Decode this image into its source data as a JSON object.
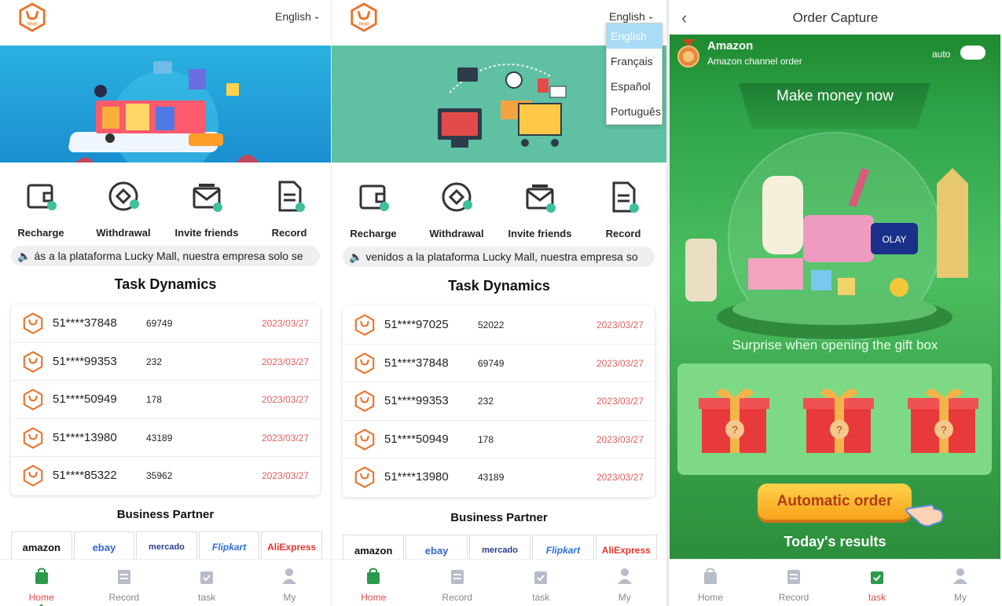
{
  "screen1": {
    "language": "English",
    "actions": [
      "Recharge",
      "Withdrawal",
      "Invite friends",
      "Record"
    ],
    "marquee": "ás a la plataforma Lucky Mall, nuestra empresa solo se",
    "task_title": "Task Dynamics",
    "tasks": [
      {
        "id": "51****37848",
        "amount": "69749",
        "date": "2023/03/27"
      },
      {
        "id": "51****99353",
        "amount": "232",
        "date": "2023/03/27"
      },
      {
        "id": "51****50949",
        "amount": "178",
        "date": "2023/03/27"
      },
      {
        "id": "51****13980",
        "amount": "43189",
        "date": "2023/03/27"
      },
      {
        "id": "51****85322",
        "amount": "35962",
        "date": "2023/03/27"
      }
    ],
    "partner_title": "Business Partner",
    "partners": [
      "amazon",
      "ebay",
      "mercado",
      "Flipkart",
      "AliExpress"
    ],
    "tabs": [
      "Home",
      "Record",
      "task",
      "My"
    ]
  },
  "screen2": {
    "language": "English",
    "language_options": [
      "English",
      "Français",
      "Español",
      "Português"
    ],
    "actions": [
      "Recharge",
      "Withdrawal",
      "Invite friends",
      "Record"
    ],
    "marquee": "venidos a la plataforma Lucky Mall, nuestra empresa so",
    "task_title": "Task Dynamics",
    "tasks": [
      {
        "id": "51****97025",
        "amount": "52022",
        "date": "2023/03/27"
      },
      {
        "id": "51****37848",
        "amount": "69749",
        "date": "2023/03/27"
      },
      {
        "id": "51****99353",
        "amount": "232",
        "date": "2023/03/27"
      },
      {
        "id": "51****50949",
        "amount": "178",
        "date": "2023/03/27"
      },
      {
        "id": "51****13980",
        "amount": "43189",
        "date": "2023/03/27"
      }
    ],
    "partner_title": "Business Partner",
    "partners": [
      "amazon",
      "ebay",
      "mercado",
      "Flipkart",
      "AliExpress"
    ],
    "tabs": [
      "Home",
      "Record",
      "task",
      "My"
    ]
  },
  "screen3": {
    "title": "Order Capture",
    "channel_name": "Amazon",
    "channel_sub": "Amazon channel order",
    "auto_label": "auto",
    "headline": "Make money now",
    "surprise": "Surprise when opening the gift box",
    "button": "Automatic order",
    "results": "Today's results",
    "tabs": [
      "Home",
      "Record",
      "task",
      "My"
    ]
  },
  "colors": {
    "brand": "#e8732c",
    "accent_green": "#2b9a4a",
    "date_red": "#e06060",
    "active_tab": "#e54a4a"
  }
}
